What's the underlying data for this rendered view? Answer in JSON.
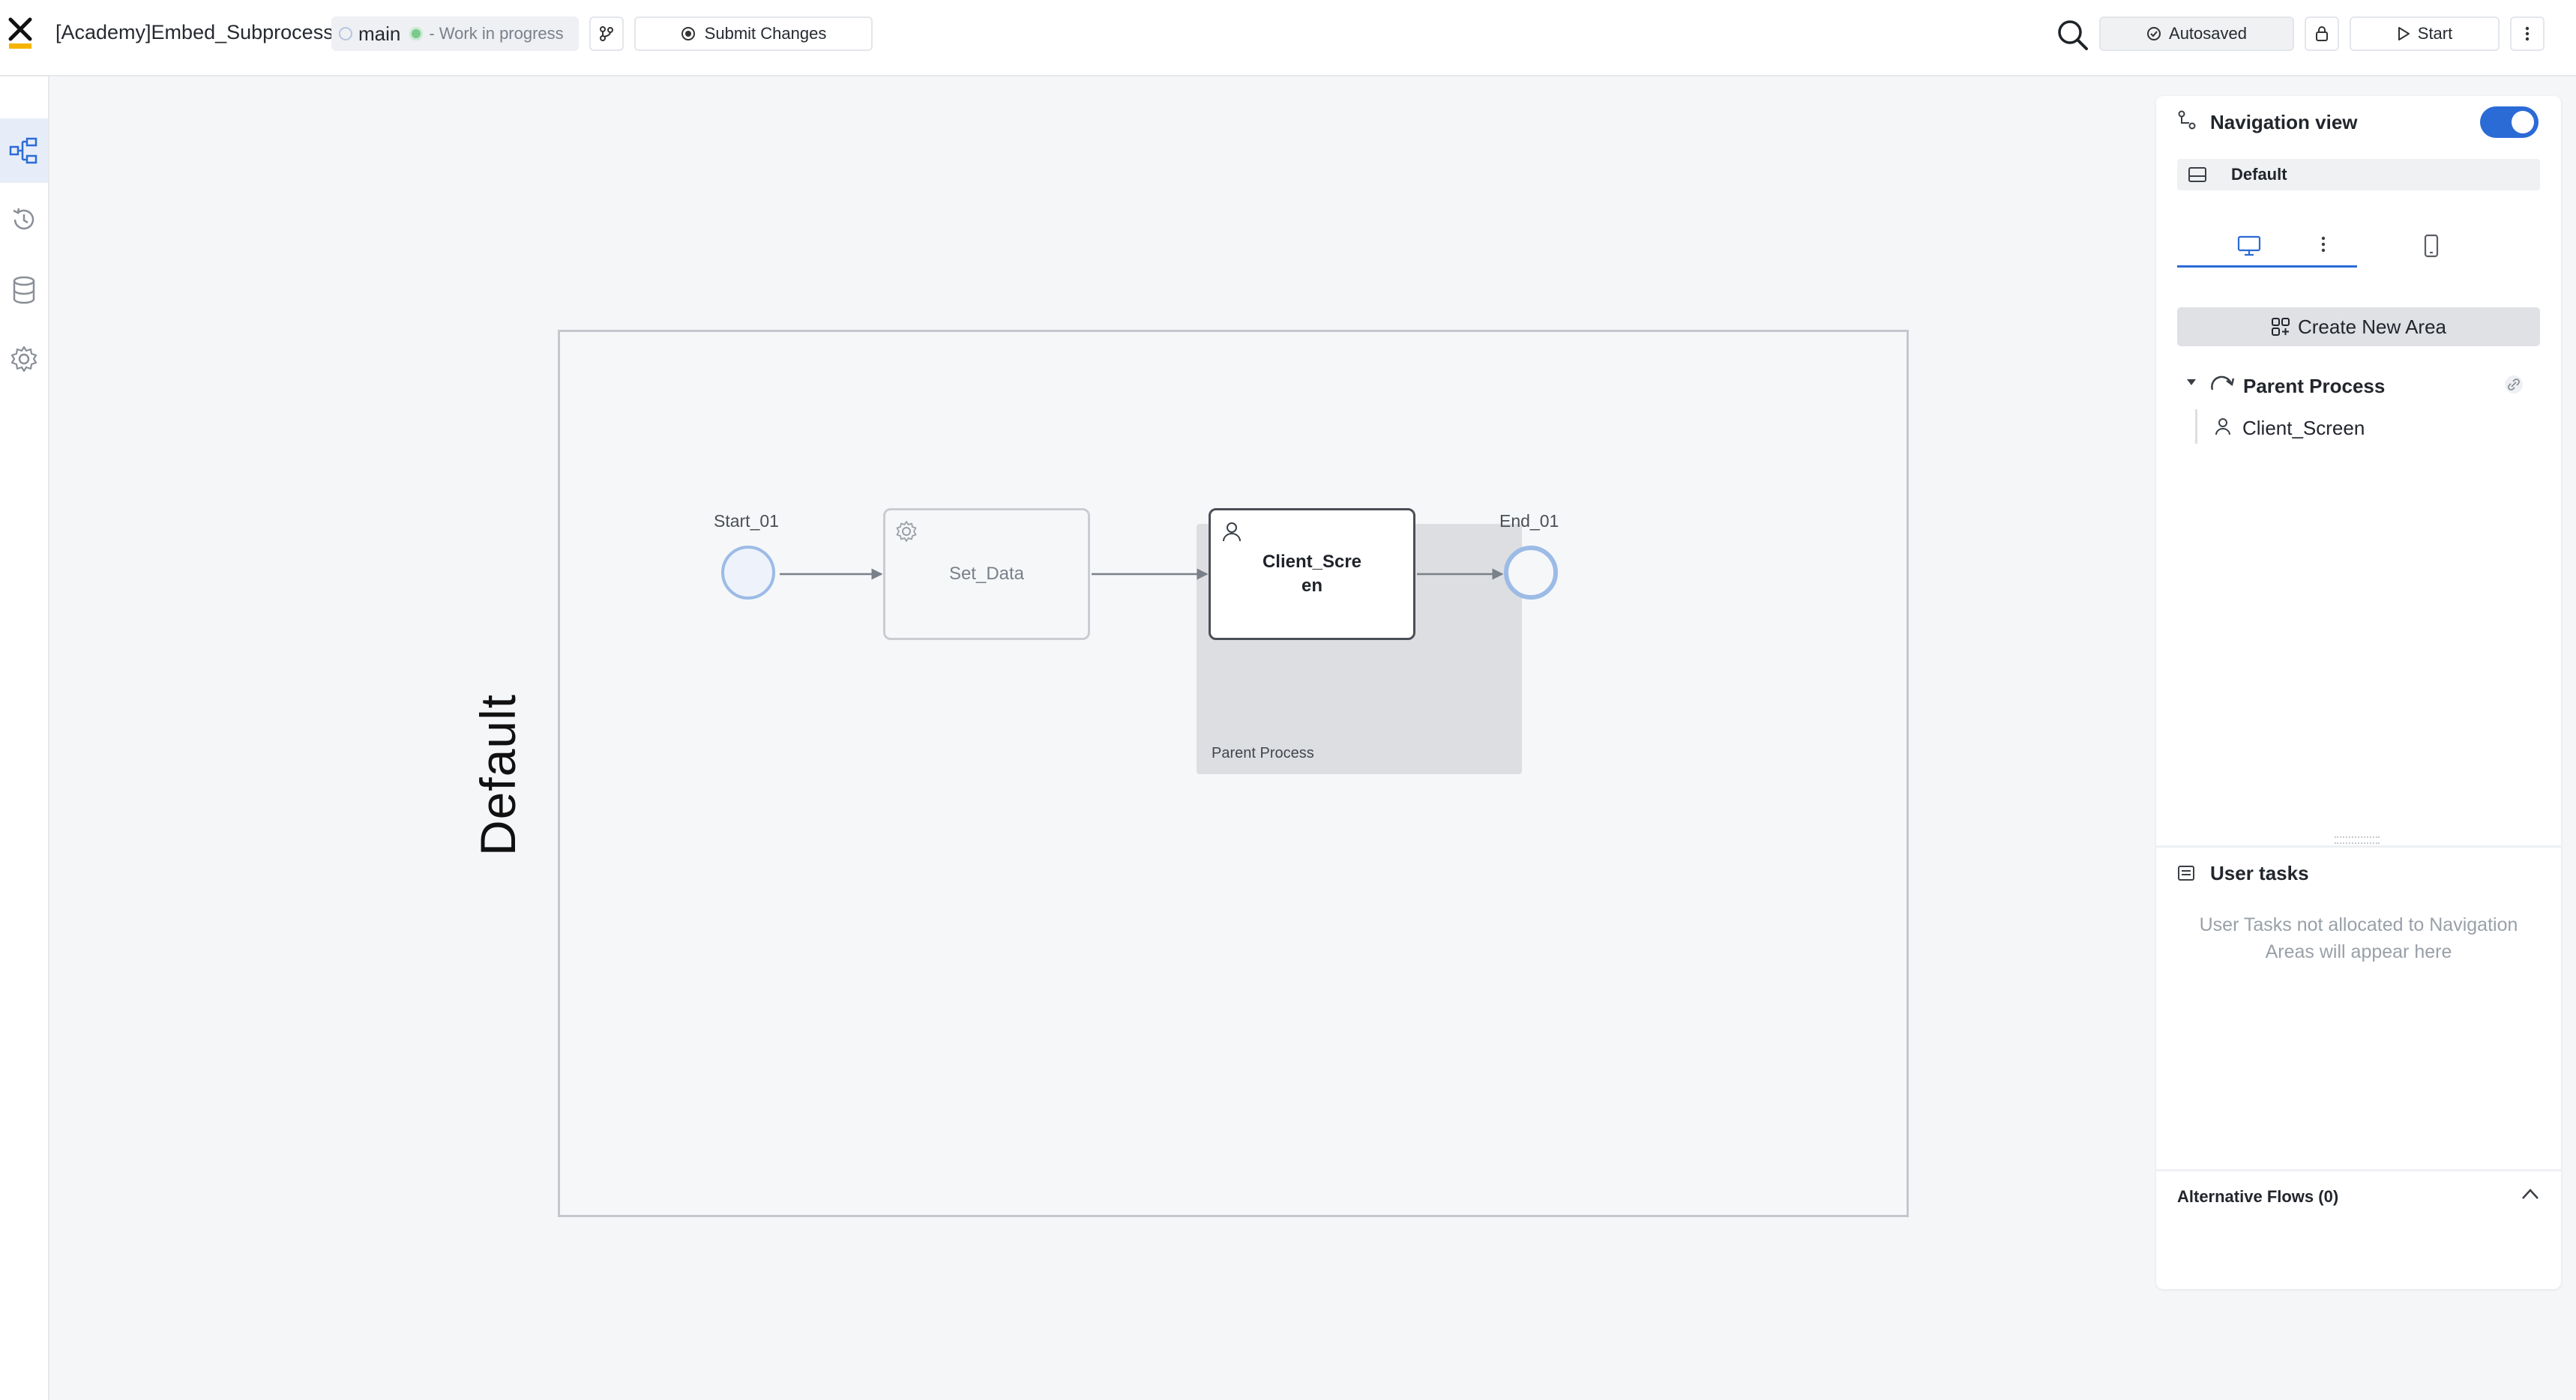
{
  "header": {
    "app_title": "[Academy]Embed_Subprocess",
    "branch": "main",
    "branch_status": "- Work in progress",
    "submit_label": "Submit Changes",
    "autosave_label": "Autosaved",
    "start_label": "Start"
  },
  "sidebar": {
    "items": [
      {
        "name": "process-flow",
        "active": true
      },
      {
        "name": "history",
        "active": false
      },
      {
        "name": "data-model",
        "active": false
      },
      {
        "name": "settings",
        "active": false
      }
    ]
  },
  "diagram": {
    "lane_label": "Default",
    "subprocess_label": "Parent Process",
    "start_event": "Start_01",
    "task_service": "Set_Data",
    "task_user_line1": "Client_Scre",
    "task_user_line2": "en",
    "end_event": "End_01"
  },
  "nav_panel": {
    "title": "Navigation view",
    "toggle_on": true,
    "default_area": "Default",
    "create_area_label": "Create New Area",
    "tree": {
      "parent": "Parent Process",
      "child": "Client_Screen"
    },
    "user_tasks_title": "User tasks",
    "user_tasks_empty_line1": "User Tasks not allocated to Navigation",
    "user_tasks_empty_line2": "Areas will appear here",
    "alt_flows_label": "Alternative Flows (0)"
  },
  "colors": {
    "accent": "#2b6bd6",
    "event_border": "#9cbbe6",
    "subprocess_fill": "#dcdee2"
  }
}
